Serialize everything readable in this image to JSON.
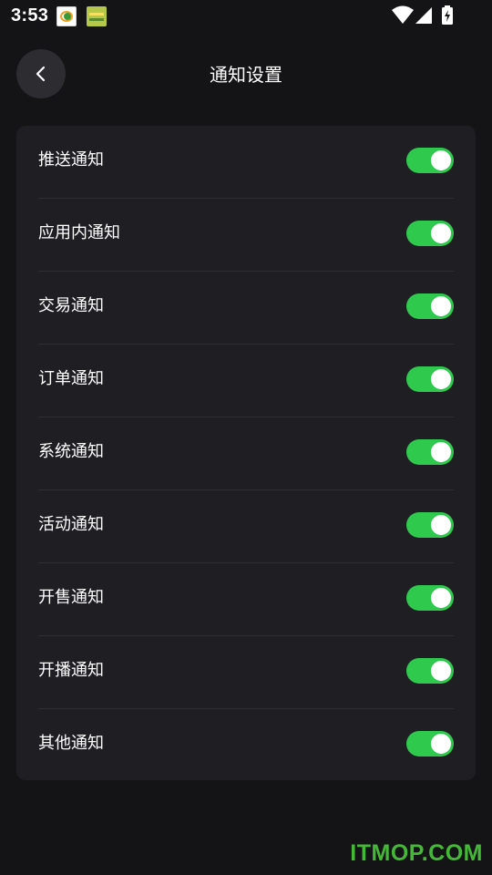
{
  "status_bar": {
    "time": "3:53",
    "icons": [
      "app-icon-1",
      "app-icon-2",
      "wifi-icon",
      "signal-icon",
      "battery-charging-icon"
    ]
  },
  "header": {
    "title": "通知设置",
    "back_icon": "chevron-left-icon"
  },
  "settings": [
    {
      "label": "推送通知",
      "enabled": true
    },
    {
      "label": "应用内通知",
      "enabled": true
    },
    {
      "label": "交易通知",
      "enabled": true
    },
    {
      "label": "订单通知",
      "enabled": true
    },
    {
      "label": "系统通知",
      "enabled": true
    },
    {
      "label": "活动通知",
      "enabled": true
    },
    {
      "label": "开售通知",
      "enabled": true
    },
    {
      "label": "开播通知",
      "enabled": true
    },
    {
      "label": "其他通知",
      "enabled": true
    }
  ],
  "watermark": "ITMOP.COM",
  "colors": {
    "background": "#141417",
    "card": "#1f1f23",
    "toggle_on": "#2ec94d",
    "watermark": "#46b838"
  }
}
